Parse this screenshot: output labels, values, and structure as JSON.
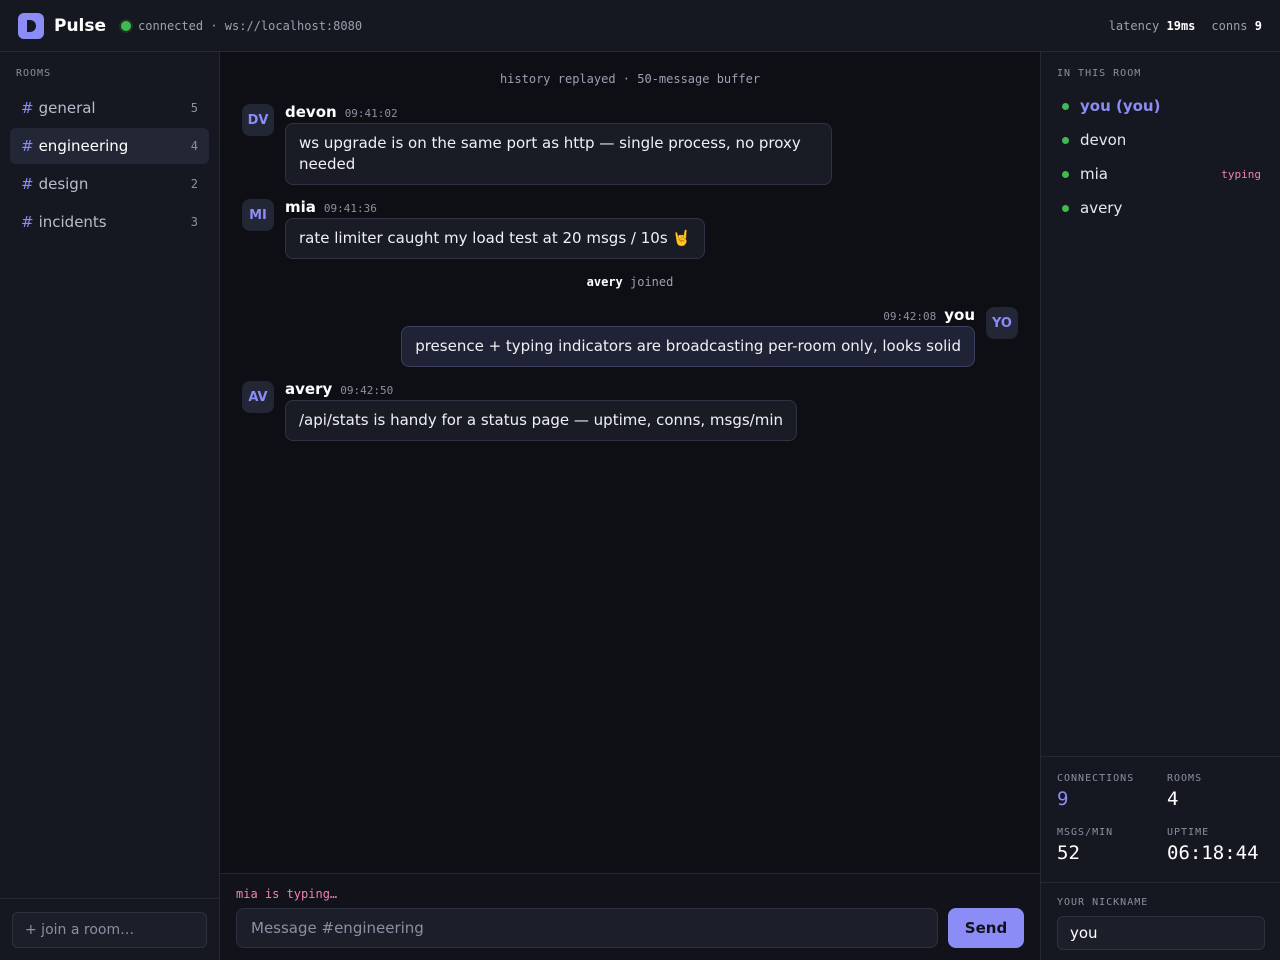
{
  "header": {
    "brand": "Pulse",
    "status": "connected",
    "separator": "·",
    "endpoint": "ws://localhost:8080",
    "latency_label": "latency",
    "latency_value": "19ms",
    "conns_label": "conns",
    "conns_value": "9"
  },
  "sidebar": {
    "section_label": "ROOMS",
    "rooms": [
      {
        "name": "general",
        "count": "5"
      },
      {
        "name": "engineering",
        "count": "4"
      },
      {
        "name": "design",
        "count": "2"
      },
      {
        "name": "incidents",
        "count": "3"
      }
    ],
    "active_room": "engineering",
    "join_placeholder": "+ join a room…"
  },
  "chat": {
    "system_notice": "history replayed · 50-message buffer",
    "messages": [
      {
        "initials": "DV",
        "author": "devon",
        "time": "09:41:02",
        "text": "ws upgrade is on the same port as http — single process, no proxy needed"
      },
      {
        "initials": "MI",
        "author": "mia",
        "time": "09:41:36",
        "text": "rate limiter caught my load test at 20 msgs / 10s 🤘"
      },
      {
        "initials": "YO",
        "author": "you",
        "time": "09:42:08",
        "text": "presence + typing indicators are broadcasting per-room only, looks solid"
      },
      {
        "initials": "AV",
        "author": "avery",
        "time": "09:42:50",
        "text": "/api/stats is handy for a status page — uptime, conns, msgs/min"
      }
    ],
    "join_event": {
      "user": "avery",
      "action": "joined"
    }
  },
  "composer": {
    "typing_indicator": "mia is typing…",
    "placeholder": "Message #engineering",
    "send_label": "Send"
  },
  "presence": {
    "section_label": "IN THIS ROOM",
    "members": [
      {
        "name": "you (you)",
        "tag": ""
      },
      {
        "name": "devon",
        "tag": ""
      },
      {
        "name": "mia",
        "tag": "typing"
      },
      {
        "name": "avery",
        "tag": ""
      }
    ]
  },
  "stats": {
    "connections_label": "CONNECTIONS",
    "connections_value": "9",
    "rooms_label": "ROOMS",
    "rooms_value": "4",
    "msgs_label": "MSGS/MIN",
    "msgs_value": "52",
    "uptime_label": "UPTIME",
    "uptime_value": "06:18:44"
  },
  "nickname": {
    "label": "YOUR NICKNAME",
    "value": "you"
  },
  "colors": {
    "accent": "#8b8cf5",
    "online": "#3fb950",
    "typing": "#f47fb5"
  }
}
